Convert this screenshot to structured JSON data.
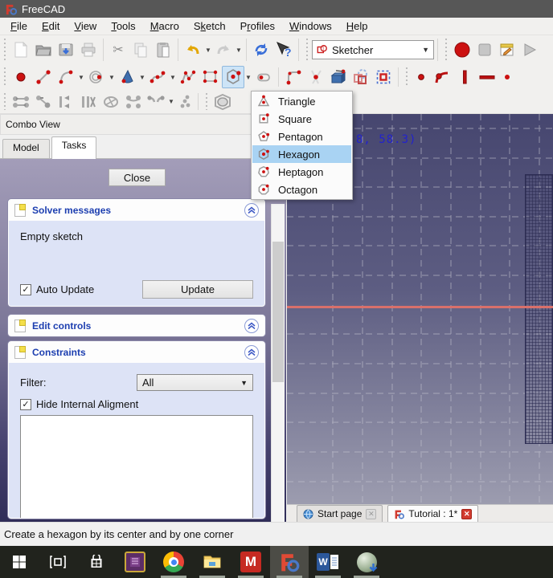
{
  "titlebar": {
    "title": "FreeCAD"
  },
  "menubar": {
    "items": [
      {
        "label": "File",
        "u": 0
      },
      {
        "label": "Edit",
        "u": 0
      },
      {
        "label": "View",
        "u": 0
      },
      {
        "label": "Tools",
        "u": 0
      },
      {
        "label": "Macro",
        "u": 0
      },
      {
        "label": "Sketch",
        "u": 1
      },
      {
        "label": "Profiles",
        "u": 1
      },
      {
        "label": "Windows",
        "u": 0
      },
      {
        "label": "Help",
        "u": 0
      }
    ]
  },
  "toolbars": {
    "workbench": {
      "selected": "Sketcher"
    }
  },
  "polygon_menu": {
    "selected": "Hexagon",
    "items": [
      {
        "label": "Triangle"
      },
      {
        "label": "Square"
      },
      {
        "label": "Pentagon"
      },
      {
        "label": "Hexagon"
      },
      {
        "label": "Heptagon"
      },
      {
        "label": "Octagon"
      }
    ]
  },
  "combo_view": {
    "title": "Combo View",
    "tabs": {
      "model": "Model",
      "tasks": "Tasks"
    },
    "close_button": "Close",
    "solver": {
      "title": "Solver messages",
      "message": "Empty sketch",
      "auto_update_label": "Auto Update",
      "auto_update_checked": "✓",
      "update_button": "Update"
    },
    "edit_controls": {
      "title": "Edit controls"
    },
    "constraints": {
      "title": "Constraints",
      "filter_label": "Filter:",
      "filter_value": "All",
      "hide_internal_label": "Hide Internal Aligment",
      "hide_internal_checked": "✓"
    }
  },
  "viewport": {
    "coordinate_readout": "8, 58.3)"
  },
  "mdi_tabs": {
    "start_page": "Start page",
    "tutorial": "Tutorial : 1*"
  },
  "status_bar": {
    "text": "Create a hexagon by its center and by one corner"
  },
  "taskbar": {
    "icons": [
      "start",
      "task-view",
      "store",
      "app-purple",
      "chrome",
      "file-explorer",
      "app-m",
      "freecad",
      "word",
      "installer-sphere"
    ],
    "app_m_letter": "M",
    "word_letter": "W"
  },
  "colors": {
    "selection_blue": "#a9d3f3",
    "section_title_blue": "#1c3eb0",
    "axis_red": "#d9706b",
    "coordinate_blue": "#2222cc",
    "record_red": "#cc1111"
  }
}
